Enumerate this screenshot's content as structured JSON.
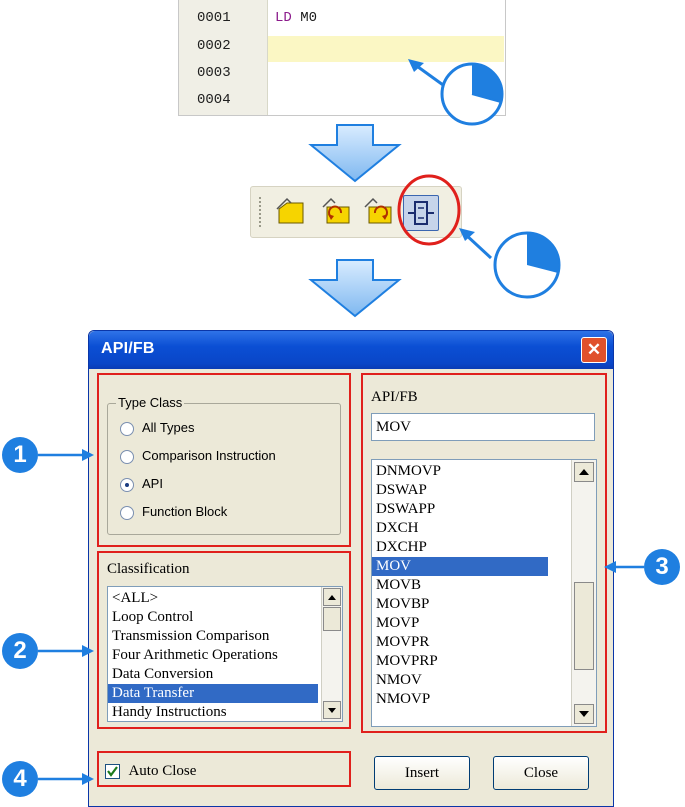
{
  "editor": {
    "lines": [
      "0001",
      "0002",
      "0003",
      "0004"
    ],
    "code_keyword": "LD",
    "code_operand": "M0"
  },
  "toolbar": {
    "icons": [
      "new-comment-icon",
      "undo-icon",
      "redo-icon",
      "api-fb-icon"
    ]
  },
  "dialog": {
    "title": "API/FB",
    "close_glyph": "✕",
    "type_class": {
      "legend": "Type Class",
      "options": [
        "All Types",
        "Comparison Instruction",
        "API",
        "Function Block"
      ],
      "selected": "API"
    },
    "classification": {
      "label": "Classification",
      "items": [
        "<ALL>",
        "Loop Control",
        "Transmission Comparison",
        "Four Arithmetic Operations",
        "Data Conversion",
        "Data Transfer",
        "Handy Instructions"
      ],
      "selected": "Data Transfer"
    },
    "api_fb": {
      "label": "API/FB",
      "input_value": "MOV",
      "items": [
        "DNMOVP",
        "DSWAP",
        "DSWAPP",
        "DXCH",
        "DXCHP",
        "MOV",
        "MOVB",
        "MOVBP",
        "MOVP",
        "MOVPR",
        "MOVPRP",
        "NMOV",
        "NMOVP"
      ],
      "selected": "MOV"
    },
    "auto_close_label": "Auto Close",
    "auto_close_checked": true,
    "insert_label": "Insert",
    "close_label": "Close"
  },
  "callouts": [
    "1",
    "2",
    "3",
    "4"
  ],
  "colors": {
    "accent_blue": "#1f7fe0",
    "highlight_red": "#e0201c",
    "selection": "#316ac5",
    "titlebar": "#0b4fd4"
  }
}
